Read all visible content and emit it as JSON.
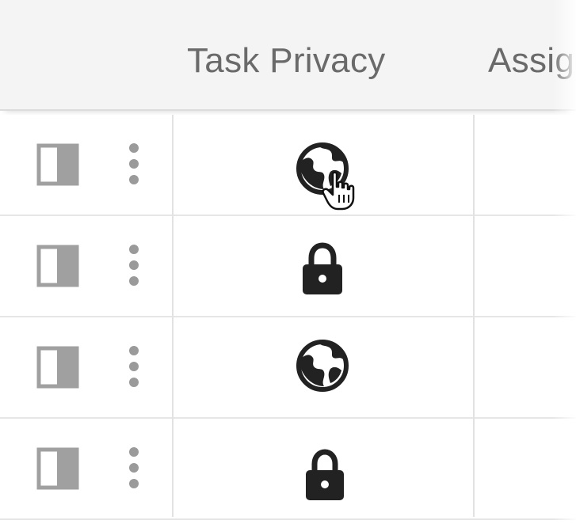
{
  "table": {
    "columns": {
      "privacy_header": "Task Privacy",
      "assignee_header": "Assig"
    },
    "rows": [
      {
        "privacy": "public",
        "privacy_icon": "globe-icon"
      },
      {
        "privacy": "private",
        "privacy_icon": "lock-icon"
      },
      {
        "privacy": "public",
        "privacy_icon": "globe-icon"
      },
      {
        "privacy": "private",
        "privacy_icon": "lock-icon"
      }
    ]
  },
  "icons": {
    "row_select": "row-select-icon",
    "row_menu": "kebab-menu-icon",
    "cursor": "hand-pointer-icon"
  },
  "colors": {
    "header_bg": "#f4f4f4",
    "header_text": "#6a6a6a",
    "icon_dark": "#222222",
    "icon_gray": "#9a9a9a",
    "divider": "#e2e2e2"
  }
}
